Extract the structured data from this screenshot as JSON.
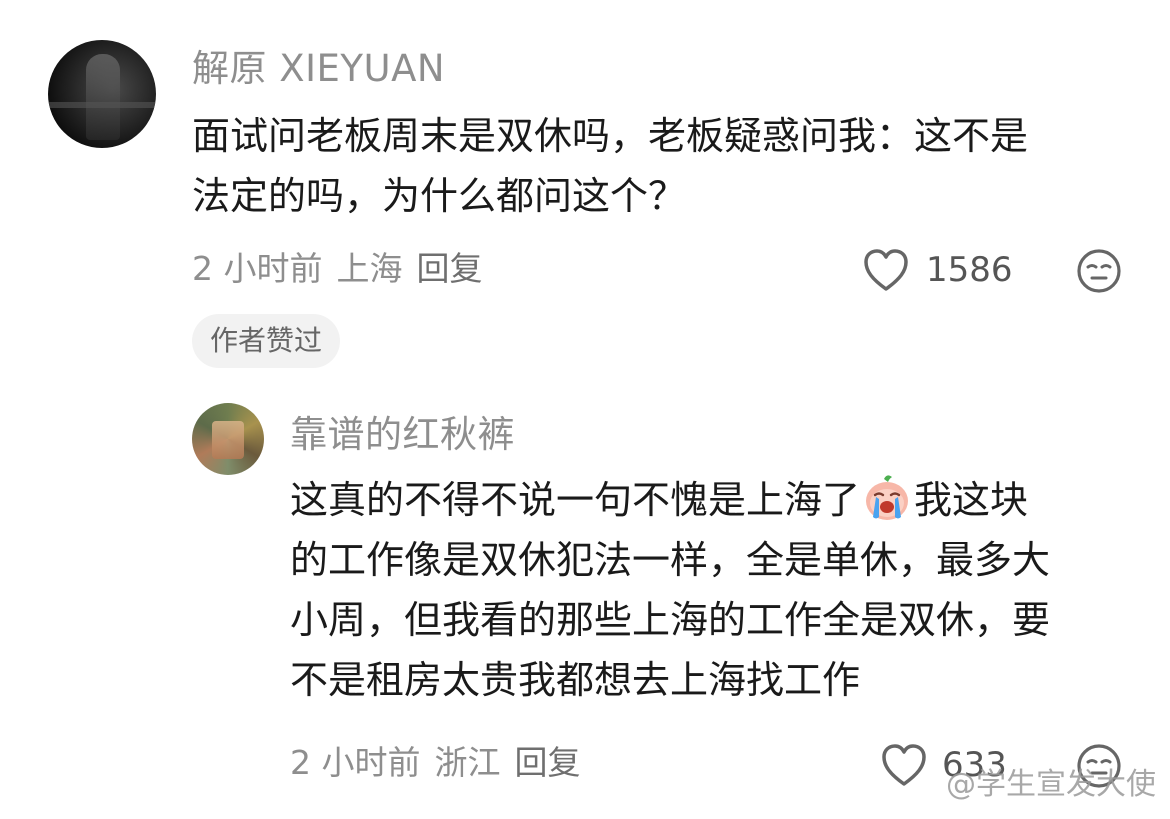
{
  "comment": {
    "username": "解原 XIEYUAN",
    "content": [
      "面试问老板周末是双休吗，老板疑惑问我：这不是",
      "法定的吗，为什么都问这个？"
    ],
    "time": "2 小时前",
    "location": "上海",
    "reply_label": "回复",
    "like_count": "1586",
    "badge": "作者赞过"
  },
  "reply": {
    "username": "靠谱的红秋裤",
    "content_line1_a": "这真的不得不说一句不愧是上海了",
    "content_line1_b": "我这块",
    "content_lines": [
      "的工作像是双休犯法一样，全是单休，最多大",
      "小周，但我看的那些上海的工作全是双休，要",
      "不是租房太贵我都想去上海找工作"
    ],
    "emoji": "crying-face-emoji",
    "time": "2 小时前",
    "location": "浙江",
    "reply_label": "回复",
    "like_count": "633"
  },
  "watermark": "@学生宣发大使",
  "icons": {
    "like": "heart-outline-icon",
    "dislike": "neutral-face-icon"
  }
}
